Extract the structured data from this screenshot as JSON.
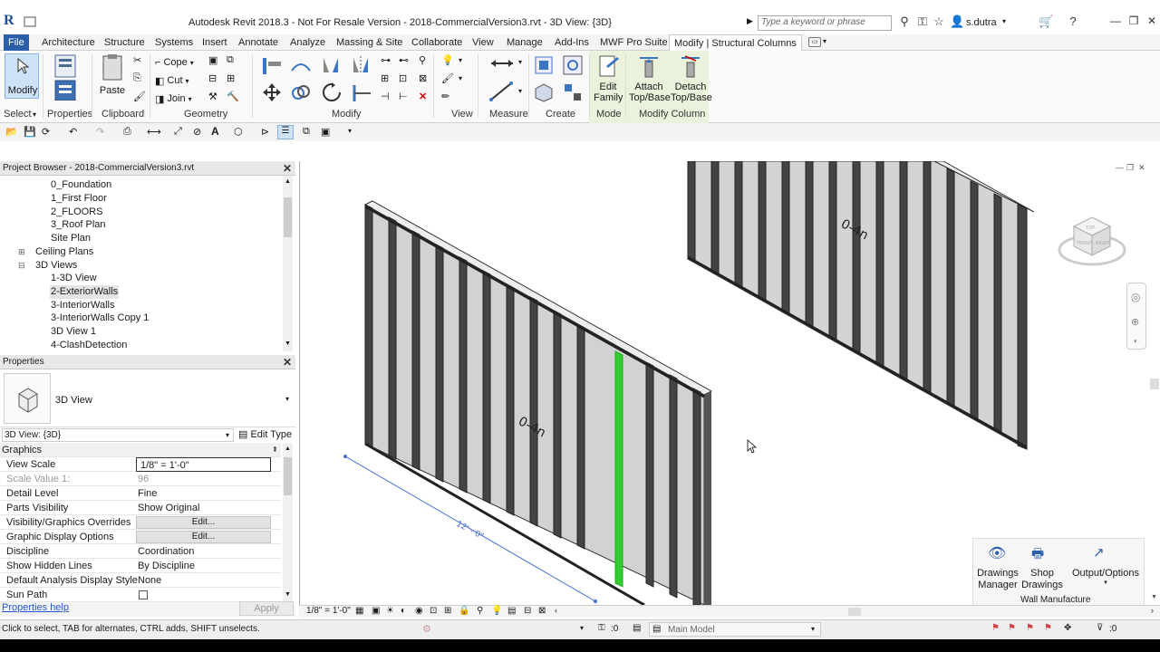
{
  "titlebar": {
    "title": "Autodesk Revit 2018.3 - Not For Resale Version -    2018-CommercialVersion3.rvt - 3D View: {3D}",
    "search_placeholder": "Type a keyword or phrase",
    "user": "s.dutra"
  },
  "tabs": [
    {
      "label": "File"
    },
    {
      "label": "Architecture"
    },
    {
      "label": "Structure"
    },
    {
      "label": "Systems"
    },
    {
      "label": "Insert"
    },
    {
      "label": "Annotate"
    },
    {
      "label": "Analyze"
    },
    {
      "label": "Massing & Site"
    },
    {
      "label": "Collaborate"
    },
    {
      "label": "View"
    },
    {
      "label": "Manage"
    },
    {
      "label": "Add-Ins"
    },
    {
      "label": "MWF Pro Suite"
    },
    {
      "label": "Modify | Structural Columns"
    }
  ],
  "ribbon": {
    "modify_label": "Modify",
    "paste_label": "Paste",
    "cope_label": "Cope",
    "cut_label": "Cut",
    "join_label": "Join",
    "edit_family_label1": "Edit",
    "edit_family_label2": "Family",
    "attach_label1": "Attach",
    "attach_label2": "Top/Base",
    "detach_label1": "Detach",
    "detach_label2": "Top/Base",
    "panels": {
      "select": "Select",
      "properties": "Properties",
      "clipboard": "Clipboard",
      "geometry": "Geometry",
      "modify": "Modify",
      "view": "View",
      "measure": "Measure",
      "create": "Create",
      "mode": "Mode",
      "modify_column": "Modify Column"
    }
  },
  "project_browser": {
    "title": "Project Browser - 2018-CommercialVersion3.rvt",
    "items": [
      {
        "label": "0_Foundation",
        "indent": 2
      },
      {
        "label": "1_First Floor",
        "indent": 2
      },
      {
        "label": "2_FLOORS",
        "indent": 2
      },
      {
        "label": "3_Roof Plan",
        "indent": 2
      },
      {
        "label": "Site Plan",
        "indent": 2
      },
      {
        "label": "Ceiling Plans",
        "indent": 1,
        "expander": "+"
      },
      {
        "label": "3D Views",
        "indent": 1,
        "expander": "−"
      },
      {
        "label": "1-3D View",
        "indent": 2
      },
      {
        "label": "2-ExteriorWalls",
        "indent": 2,
        "selected": true
      },
      {
        "label": "3-InteriorWalls",
        "indent": 2
      },
      {
        "label": "3-InteriorWalls Copy 1",
        "indent": 2
      },
      {
        "label": "3D View 1",
        "indent": 2
      },
      {
        "label": "4-ClashDetection",
        "indent": 2
      }
    ]
  },
  "properties": {
    "title": "Properties",
    "type_name": "3D View",
    "instance_selector": "3D View: {3D}",
    "edit_type": "Edit Type",
    "group": "Graphics",
    "rows": [
      {
        "name": "View Scale",
        "value": "1/8\" = 1'-0\"",
        "kind": "input"
      },
      {
        "name": "Scale Value    1:",
        "value": "96",
        "kind": "greyed"
      },
      {
        "name": "Detail Level",
        "value": "Fine",
        "kind": "text"
      },
      {
        "name": "Parts Visibility",
        "value": "Show Original",
        "kind": "text"
      },
      {
        "name": "Visibility/Graphics Overrides",
        "value": "Edit...",
        "kind": "button"
      },
      {
        "name": "Graphic Display Options",
        "value": "Edit...",
        "kind": "button"
      },
      {
        "name": "Discipline",
        "value": "Coordination",
        "kind": "text"
      },
      {
        "name": "Show Hidden Lines",
        "value": "By Discipline",
        "kind": "text"
      },
      {
        "name": "Default Analysis Display Style",
        "value": "None",
        "kind": "text"
      },
      {
        "name": "Sun Path",
        "value": "",
        "kind": "checkbox"
      }
    ],
    "help": "Properties help",
    "apply": "Apply"
  },
  "canvas": {
    "dimension_label": "12' - 0\"",
    "wall_tag": "0-4n",
    "viewcube_top": "TOP",
    "viewcube_front": "FRONT",
    "viewcube_right": "RIGHT"
  },
  "addin": {
    "drawings_manager1": "Drawings",
    "drawings_manager2": "Manager",
    "shop_drawings1": "Shop",
    "shop_drawings2": "Drawings",
    "output_options": "Output/Options",
    "panel_label": "Wall Manufacture"
  },
  "view_control": {
    "scale": "1/8\" = 1'-0\""
  },
  "status": {
    "hint": "Click to select, TAB for alternates, CTRL adds, SHIFT unselects.",
    "worksets_count": ":0",
    "model": "Main Model",
    "filter_count": ":0"
  },
  "colors": {
    "file_tab": "#2a5ea8",
    "mode_panel": "#eaf2dc",
    "highlight_stud": "#33cc33",
    "selection_blue": "#4a6fd0"
  }
}
